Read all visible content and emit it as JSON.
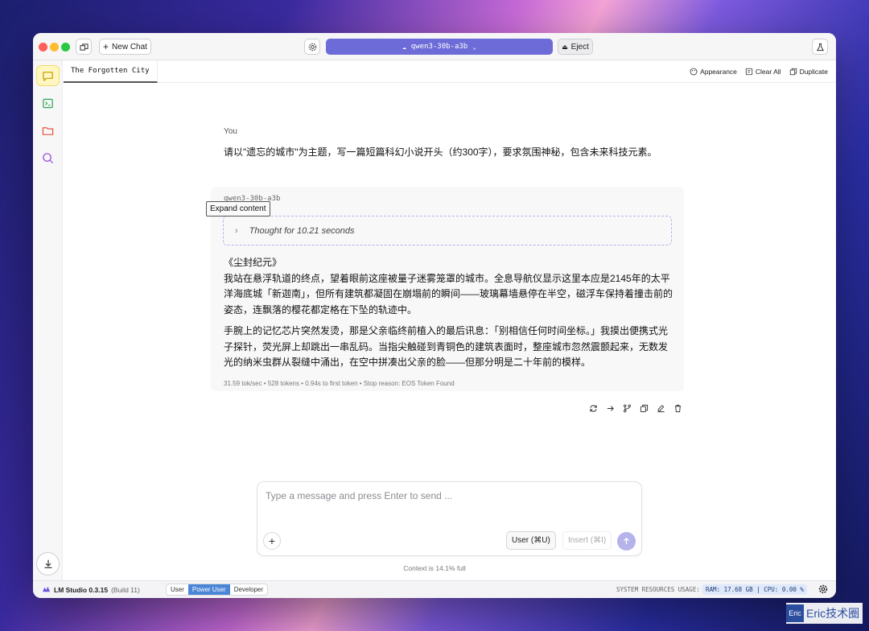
{
  "titlebar": {
    "new_chat_label": "New Chat",
    "model_name": "qwen3-30b-a3b",
    "eject_label": "Eject"
  },
  "tabs": [
    {
      "label": "The Forgotten City"
    }
  ],
  "tab_tools": {
    "appearance": "Appearance",
    "clear_all": "Clear All",
    "duplicate": "Duplicate"
  },
  "conversation": {
    "user_label": "You",
    "user_message": "请以\"遗忘的城市\"为主题，写一篇短篇科幻小说开头（约300字），要求氛围神秘，包含未来科技元素。",
    "assistant_model": "qwen3-30b-a3b",
    "tooltip": "Expand content",
    "thought": "Thought for 10.21 seconds",
    "title_line": "《尘封纪元》",
    "paragraphs": [
      "我站在悬浮轨道的终点，望着眼前这座被量子迷雾笼罩的城市。全息导航仪显示这里本应是2145年的太平洋海底城「新迦南」，但所有建筑都凝固在崩塌前的瞬间——玻璃幕墙悬停在半空，磁浮车保持着撞击前的姿态，连飘落的樱花都定格在下坠的轨迹中。",
      "手腕上的记忆芯片突然发烫，那是父亲临终前植入的最后讯息：「别相信任何时间坐标。」我摸出便携式光子探针，荧光屏上却跳出一串乱码。当指尖触碰到青铜色的建筑表面时，整座城市忽然震颤起来，无数发光的纳米虫群从裂缝中涌出，在空中拼凑出父亲的脸——但那分明是二十年前的模样。"
    ],
    "stats": "31.59 tok/sec • 528 tokens • 0.94s to first token • Stop reason: EOS Token Found"
  },
  "composer": {
    "placeholder": "Type a message and press Enter to send ...",
    "user_button": "User (⌘U)",
    "insert_button": "Insert (⌘I)",
    "context_note": "Context is 14.1% full"
  },
  "statusbar": {
    "app_name": "LM Studio 0.3.15",
    "build": "(Build 11)",
    "modes": [
      "User",
      "Power User",
      "Developer"
    ],
    "active_mode": "Power User",
    "sys_label": "SYSTEM RESOURCES USAGE:",
    "sys_value": "RAM: 17.68 GB  |  CPU: 0.00 %"
  },
  "watermark": {
    "box": "Eric",
    "text": "Eric技术圈"
  },
  "colors": {
    "accent": "#6d6bd8",
    "active_mode": "#4a86d6",
    "rail_active": "#fff6c2"
  }
}
